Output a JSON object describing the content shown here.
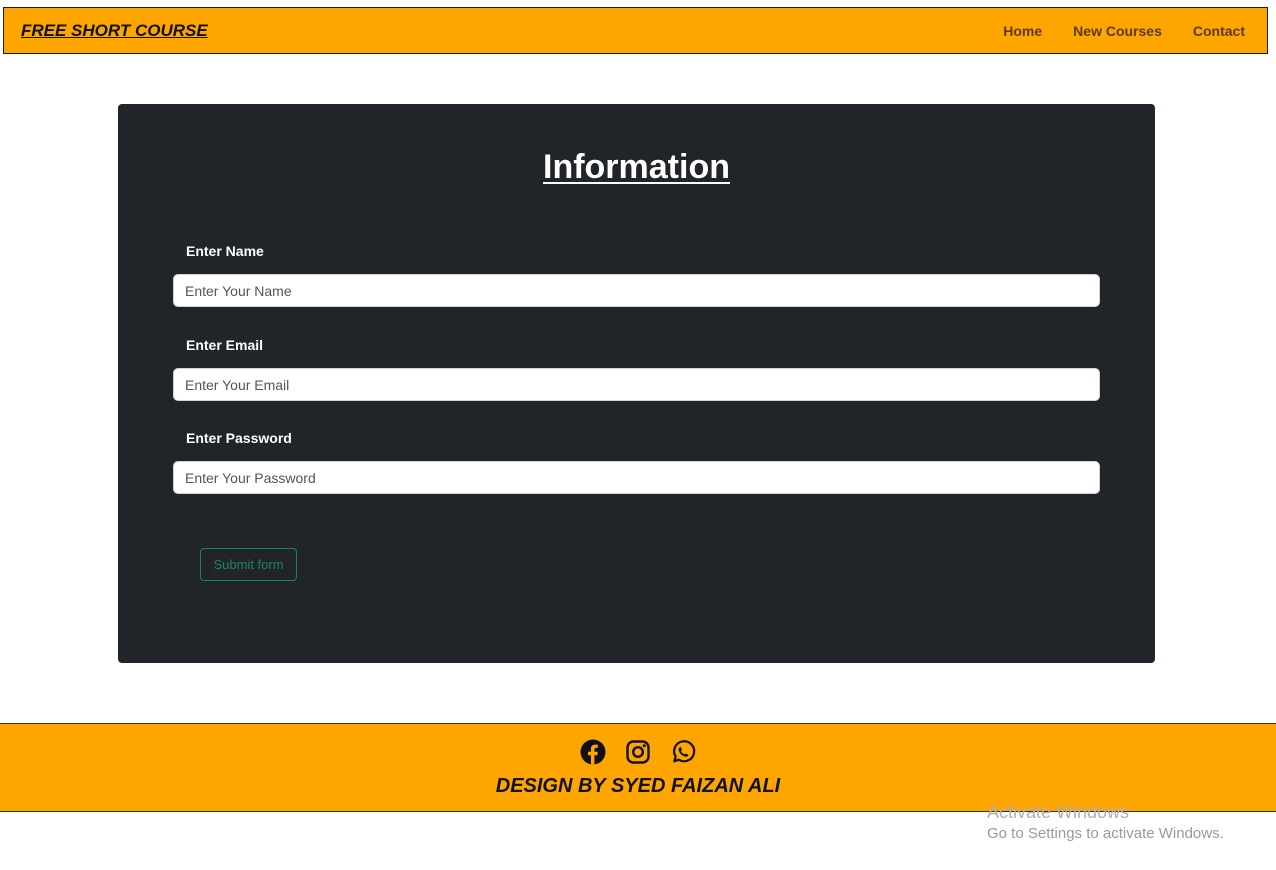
{
  "navbar": {
    "brand": "FREE SHORT COURSE",
    "links": [
      "Home",
      "New Courses",
      "Contact"
    ],
    "background_color": "#ffa500"
  },
  "form": {
    "title": "Information",
    "fields": [
      {
        "label": "Enter Name",
        "placeholder": "Enter Your Name",
        "value": ""
      },
      {
        "label": "Enter Email",
        "placeholder": "Enter Your Email",
        "value": ""
      },
      {
        "label": "Enter Password",
        "placeholder": "Enter Your Password",
        "value": ""
      }
    ],
    "submit_label": "Submit form",
    "background_color": "#212529",
    "submit_color": "#198754"
  },
  "footer": {
    "icons": [
      "facebook-icon",
      "instagram-icon",
      "whatsapp-icon"
    ],
    "credit": "DESIGN BY SYED FAIZAN ALI"
  },
  "watermark": {
    "title": "Activate Windows",
    "subtitle": "Go to Settings to activate Windows."
  }
}
